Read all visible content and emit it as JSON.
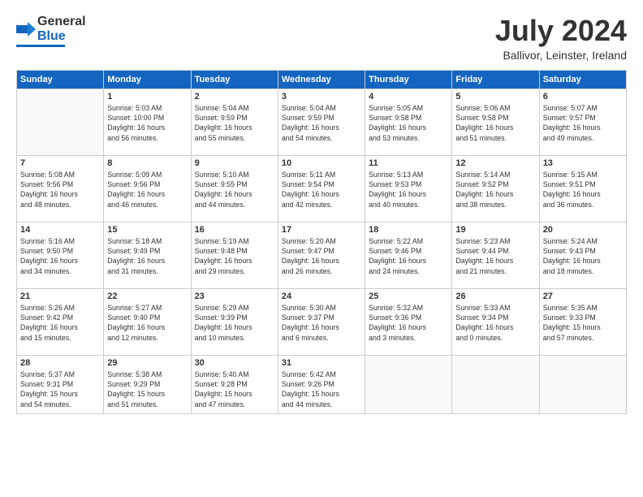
{
  "header": {
    "logo": {
      "line1": "General",
      "line2": "Blue"
    },
    "title": "July 2024",
    "location": "Ballivor, Leinster, Ireland"
  },
  "days_of_week": [
    "Sunday",
    "Monday",
    "Tuesday",
    "Wednesday",
    "Thursday",
    "Friday",
    "Saturday"
  ],
  "weeks": [
    {
      "days": [
        {
          "num": "",
          "info": ""
        },
        {
          "num": "1",
          "info": "Sunrise: 5:03 AM\nSunset: 10:00 PM\nDaylight: 16 hours\nand 56 minutes."
        },
        {
          "num": "2",
          "info": "Sunrise: 5:04 AM\nSunset: 9:59 PM\nDaylight: 16 hours\nand 55 minutes."
        },
        {
          "num": "3",
          "info": "Sunrise: 5:04 AM\nSunset: 9:59 PM\nDaylight: 16 hours\nand 54 minutes."
        },
        {
          "num": "4",
          "info": "Sunrise: 5:05 AM\nSunset: 9:58 PM\nDaylight: 16 hours\nand 53 minutes."
        },
        {
          "num": "5",
          "info": "Sunrise: 5:06 AM\nSunset: 9:58 PM\nDaylight: 16 hours\nand 51 minutes."
        },
        {
          "num": "6",
          "info": "Sunrise: 5:07 AM\nSunset: 9:57 PM\nDaylight: 16 hours\nand 49 minutes."
        }
      ]
    },
    {
      "days": [
        {
          "num": "7",
          "info": "Sunrise: 5:08 AM\nSunset: 9:56 PM\nDaylight: 16 hours\nand 48 minutes."
        },
        {
          "num": "8",
          "info": "Sunrise: 5:09 AM\nSunset: 9:56 PM\nDaylight: 16 hours\nand 46 minutes."
        },
        {
          "num": "9",
          "info": "Sunrise: 5:10 AM\nSunset: 9:55 PM\nDaylight: 16 hours\nand 44 minutes."
        },
        {
          "num": "10",
          "info": "Sunrise: 5:11 AM\nSunset: 9:54 PM\nDaylight: 16 hours\nand 42 minutes."
        },
        {
          "num": "11",
          "info": "Sunrise: 5:13 AM\nSunset: 9:53 PM\nDaylight: 16 hours\nand 40 minutes."
        },
        {
          "num": "12",
          "info": "Sunrise: 5:14 AM\nSunset: 9:52 PM\nDaylight: 16 hours\nand 38 minutes."
        },
        {
          "num": "13",
          "info": "Sunrise: 5:15 AM\nSunset: 9:51 PM\nDaylight: 16 hours\nand 36 minutes."
        }
      ]
    },
    {
      "days": [
        {
          "num": "14",
          "info": "Sunrise: 5:16 AM\nSunset: 9:50 PM\nDaylight: 16 hours\nand 34 minutes."
        },
        {
          "num": "15",
          "info": "Sunrise: 5:18 AM\nSunset: 9:49 PM\nDaylight: 16 hours\nand 31 minutes."
        },
        {
          "num": "16",
          "info": "Sunrise: 5:19 AM\nSunset: 9:48 PM\nDaylight: 16 hours\nand 29 minutes."
        },
        {
          "num": "17",
          "info": "Sunrise: 5:20 AM\nSunset: 9:47 PM\nDaylight: 16 hours\nand 26 minutes."
        },
        {
          "num": "18",
          "info": "Sunrise: 5:22 AM\nSunset: 9:46 PM\nDaylight: 16 hours\nand 24 minutes."
        },
        {
          "num": "19",
          "info": "Sunrise: 5:23 AM\nSunset: 9:44 PM\nDaylight: 16 hours\nand 21 minutes."
        },
        {
          "num": "20",
          "info": "Sunrise: 5:24 AM\nSunset: 9:43 PM\nDaylight: 16 hours\nand 18 minutes."
        }
      ]
    },
    {
      "days": [
        {
          "num": "21",
          "info": "Sunrise: 5:26 AM\nSunset: 9:42 PM\nDaylight: 16 hours\nand 15 minutes."
        },
        {
          "num": "22",
          "info": "Sunrise: 5:27 AM\nSunset: 9:40 PM\nDaylight: 16 hours\nand 12 minutes."
        },
        {
          "num": "23",
          "info": "Sunrise: 5:29 AM\nSunset: 9:39 PM\nDaylight: 16 hours\nand 10 minutes."
        },
        {
          "num": "24",
          "info": "Sunrise: 5:30 AM\nSunset: 9:37 PM\nDaylight: 16 hours\nand 6 minutes."
        },
        {
          "num": "25",
          "info": "Sunrise: 5:32 AM\nSunset: 9:36 PM\nDaylight: 16 hours\nand 3 minutes."
        },
        {
          "num": "26",
          "info": "Sunrise: 5:33 AM\nSunset: 9:34 PM\nDaylight: 16 hours\nand 0 minutes."
        },
        {
          "num": "27",
          "info": "Sunrise: 5:35 AM\nSunset: 9:33 PM\nDaylight: 15 hours\nand 57 minutes."
        }
      ]
    },
    {
      "days": [
        {
          "num": "28",
          "info": "Sunrise: 5:37 AM\nSunset: 9:31 PM\nDaylight: 15 hours\nand 54 minutes."
        },
        {
          "num": "29",
          "info": "Sunrise: 5:38 AM\nSunset: 9:29 PM\nDaylight: 15 hours\nand 51 minutes."
        },
        {
          "num": "30",
          "info": "Sunrise: 5:40 AM\nSunset: 9:28 PM\nDaylight: 15 hours\nand 47 minutes."
        },
        {
          "num": "31",
          "info": "Sunrise: 5:42 AM\nSunset: 9:26 PM\nDaylight: 15 hours\nand 44 minutes."
        },
        {
          "num": "",
          "info": ""
        },
        {
          "num": "",
          "info": ""
        },
        {
          "num": "",
          "info": ""
        }
      ]
    }
  ]
}
